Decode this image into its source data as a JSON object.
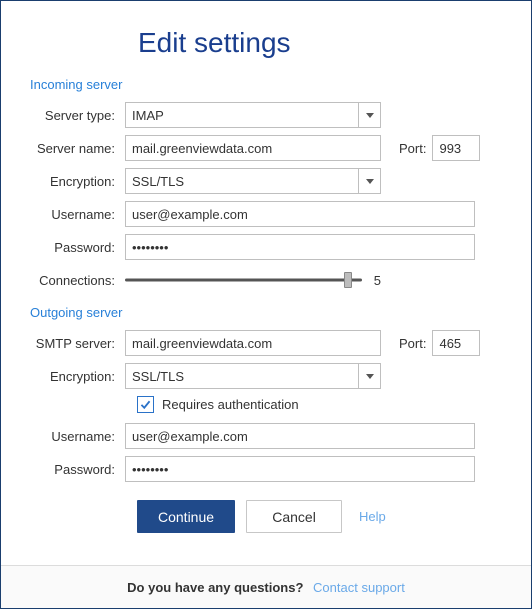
{
  "title": "Edit settings",
  "incoming": {
    "section": "Incoming server",
    "labels": {
      "server_type": "Server type:",
      "server_name": "Server name:",
      "encryption": "Encryption:",
      "username": "Username:",
      "password": "Password:",
      "connections": "Connections:",
      "port": "Port:"
    },
    "server_type": "IMAP",
    "server_name": "mail.greenviewdata.com",
    "port": "993",
    "encryption": "SSL/TLS",
    "username": "user@example.com",
    "password": "••••••••",
    "connections": "5",
    "connections_percent": 94
  },
  "outgoing": {
    "section": "Outgoing server",
    "labels": {
      "smtp_server": "SMTP server:",
      "encryption": "Encryption:",
      "requires_auth": "Requires authentication",
      "username": "Username:",
      "password": "Password:",
      "port": "Port:"
    },
    "smtp_server": "mail.greenviewdata.com",
    "port": "465",
    "encryption": "SSL/TLS",
    "requires_auth": true,
    "username": "user@example.com",
    "password": "••••••••"
  },
  "actions": {
    "continue": "Continue",
    "cancel": "Cancel",
    "help": "Help"
  },
  "footer": {
    "question": "Do you have any questions?",
    "contact": "Contact support"
  }
}
